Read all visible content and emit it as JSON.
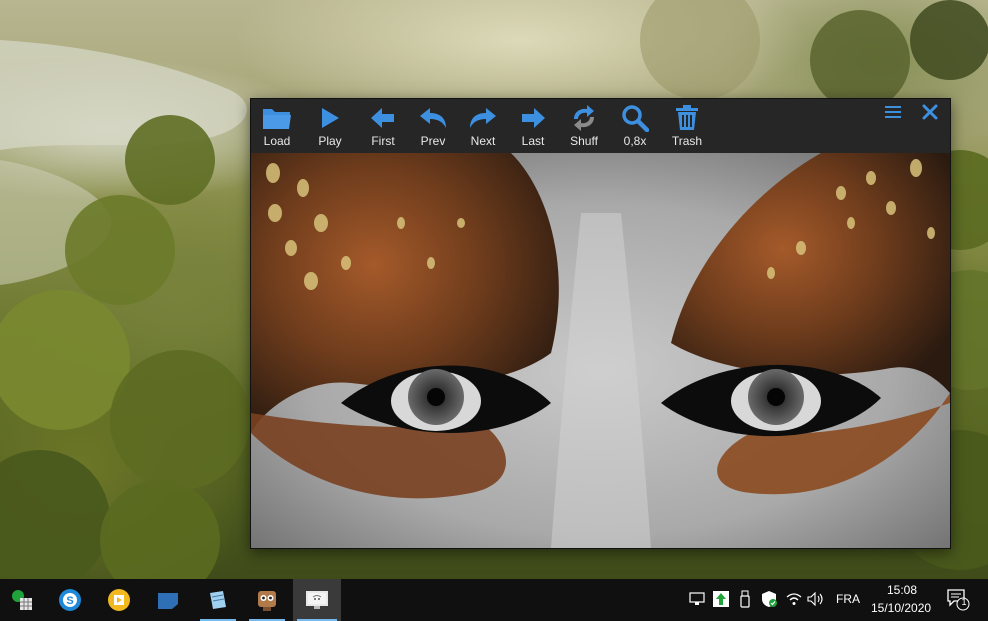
{
  "toolbar": {
    "buttons": [
      {
        "id": "load",
        "label": "Load",
        "icon": "folder-open-icon"
      },
      {
        "id": "play",
        "label": "Play",
        "icon": "play-icon"
      },
      {
        "id": "first",
        "label": "First",
        "icon": "arrow-left-icon"
      },
      {
        "id": "prev",
        "label": "Prev",
        "icon": "undo-arrow-icon"
      },
      {
        "id": "next",
        "label": "Next",
        "icon": "redo-arrow-icon"
      },
      {
        "id": "last",
        "label": "Last",
        "icon": "arrow-right-icon"
      },
      {
        "id": "shuff",
        "label": "Shuff",
        "icon": "shuffle-icon"
      },
      {
        "id": "zoom",
        "label": "0,8x",
        "icon": "magnifier-icon"
      },
      {
        "id": "trash",
        "label": "Trash",
        "icon": "trash-icon"
      }
    ],
    "accent_color": "#3d8fe0",
    "menu_icon": "hamburger-menu-icon",
    "close_icon": "close-icon"
  },
  "image": {
    "description_icon": "feather-eyes-photo"
  },
  "taskbar": {
    "apps": [
      {
        "icon": "spreadsheet-app-icon",
        "active": false,
        "underline": false
      },
      {
        "icon": "skype-like-app-icon",
        "active": false,
        "underline": false
      },
      {
        "icon": "media-player-app-icon",
        "active": false,
        "underline": false
      },
      {
        "icon": "sticky-notes-app-icon",
        "active": false,
        "underline": false
      },
      {
        "icon": "notepad-app-icon",
        "active": false,
        "underline": true
      },
      {
        "icon": "robot-app-icon",
        "active": false,
        "underline": true
      },
      {
        "icon": "slideshow-app-icon",
        "active": true,
        "underline": true
      }
    ],
    "tray": {
      "language": "FRA",
      "time": "15:08",
      "date": "15/10/2020",
      "notification_count": "1"
    }
  }
}
